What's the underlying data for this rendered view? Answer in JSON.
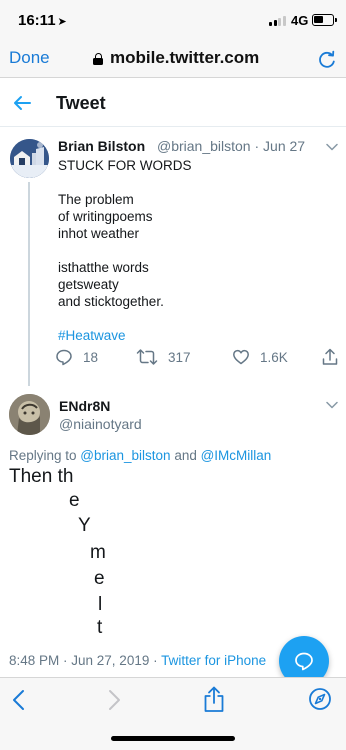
{
  "status_bar": {
    "time": "16:11",
    "location_glyph": "➤",
    "network": "4G",
    "signal_bars_active": 2,
    "signal_bars_total": 4,
    "battery_level": 0.4
  },
  "browser": {
    "done_label": "Done",
    "url": "mobile.twitter.com",
    "icons": [
      "lock-icon",
      "reload-icon"
    ]
  },
  "header": {
    "title": "Tweet",
    "back_icon": "arrow-left-icon"
  },
  "tweet": {
    "author_name": "Brian Bilston",
    "author_meta": "@brian_bilston · Jun 27",
    "lines": [
      "STUCK FOR WORDS",
      "The problem",
      "of writingpoems",
      "inhot weather",
      "isthatthe words",
      "getsweaty",
      "and sticktogether."
    ],
    "hashtag": "#Heatwave",
    "replies": "18",
    "retweets": "317",
    "likes": "1.6K",
    "icons": [
      "reply-icon",
      "retweet-icon",
      "heart-icon",
      "share-icon",
      "chevron-down-icon"
    ]
  },
  "reply": {
    "author_name": "ENdr8N",
    "author_handle": "@niainotyard",
    "replying_prefix": "Replying to ",
    "mention_1": "@brian_bilston",
    "replying_and": " and ",
    "mention_2": "@IMcMillan",
    "text_start": "Then th",
    "falling_letters": [
      "e",
      "Y",
      "m",
      "e",
      "l",
      "t"
    ],
    "timestamp": "8:48 PM · Jun 27, 2019 · ",
    "source": "Twitter for iPhone"
  },
  "fab": {
    "icon": "compose-reply-icon"
  },
  "toolbar": {
    "icons": [
      "browser-back-icon",
      "browser-forward-icon",
      "share-icon",
      "compass-icon"
    ]
  },
  "colors": {
    "accent": "#1da1f2",
    "link": "#1b95e0",
    "ios_blue": "#1a7bd6",
    "secondary_text": "#657786"
  }
}
